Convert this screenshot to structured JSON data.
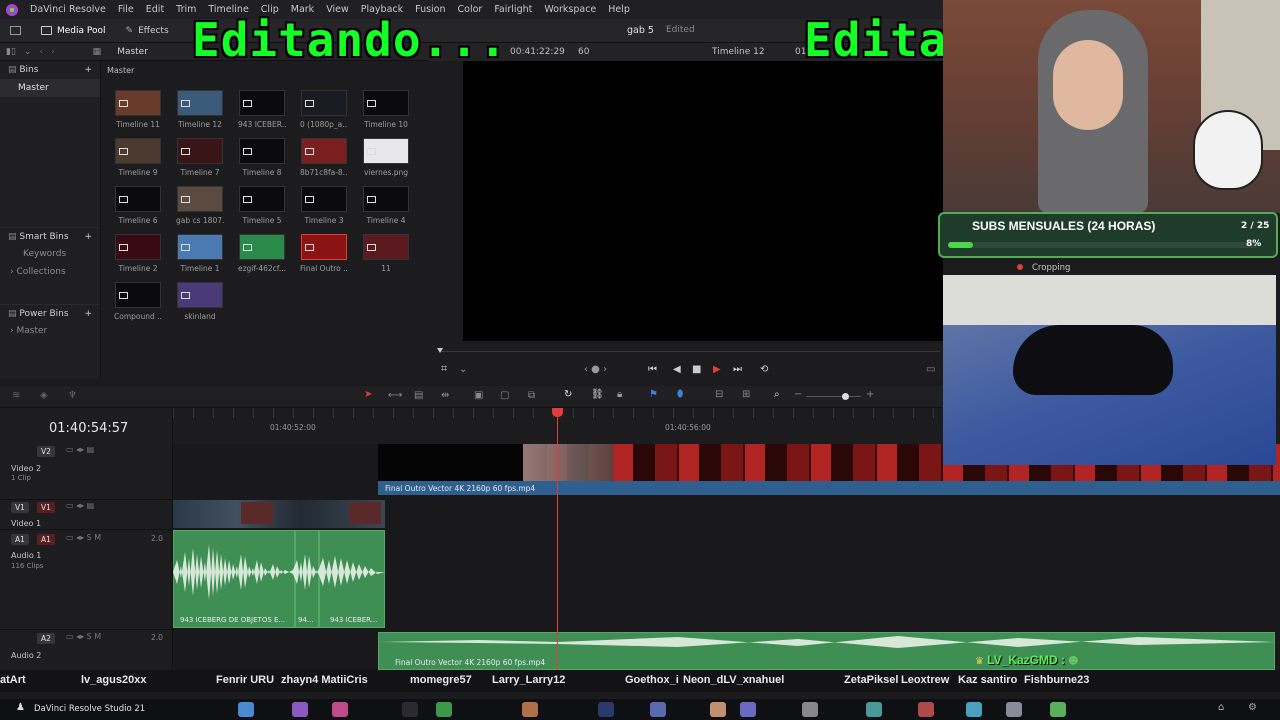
{
  "menubar": {
    "app_title": "DaVinci Resolve",
    "items": [
      "File",
      "Edit",
      "Trim",
      "Timeline",
      "Clip",
      "Mark",
      "View",
      "Playback",
      "Fusion",
      "Color",
      "Fairlight",
      "Workspace",
      "Help"
    ]
  },
  "toolbar": {
    "media_pool": "Media Pool",
    "effects": "Effects",
    "project_name": "gab 5",
    "project_status": "Edited"
  },
  "pathbar": {
    "current_bin": "Master"
  },
  "bins": {
    "header": "Bins",
    "master": "Master",
    "smart_bins_header": "Smart Bins",
    "smart_items": [
      "Keywords",
      "Collections"
    ],
    "power_bins_header": "Power Bins",
    "power_items": [
      "Master"
    ]
  },
  "mediapool": {
    "header": "Master",
    "clips": [
      {
        "label": "Timeline 11"
      },
      {
        "label": "Timeline 12"
      },
      {
        "label": "943 ICEBER..."
      },
      {
        "label": "0 (1080p_a..."
      },
      {
        "label": "Timeline 10"
      },
      {
        "label": "Timeline 9"
      },
      {
        "label": "Timeline 7"
      },
      {
        "label": "Timeline 8"
      },
      {
        "label": "8b71c8fa-8..."
      },
      {
        "label": "viernes.png"
      },
      {
        "label": "Timeline 6"
      },
      {
        "label": "gab cs 1807..."
      },
      {
        "label": "Timeline 5"
      },
      {
        "label": "Timeline 3"
      },
      {
        "label": "Timeline 4"
      },
      {
        "label": "Timeline 2"
      },
      {
        "label": "Timeline 1"
      },
      {
        "label": "ezgif-462cf..."
      },
      {
        "label": "Final Outro ..."
      },
      {
        "label": "11"
      },
      {
        "label": "Compound ..."
      },
      {
        "label": "skinland"
      }
    ]
  },
  "viewer": {
    "timecode": "00:41:22:29",
    "fps": "60",
    "timeline_name": "Timeline 12",
    "overlay_num": "01"
  },
  "timeline": {
    "current_timecode": "01:40:54:57",
    "ruler_marks": [
      "01:40:52:00",
      "01:40:56:00"
    ],
    "tracks": {
      "v2": {
        "code": "V2",
        "name": "Video 2",
        "sub": "1 Clip"
      },
      "v1": {
        "code": "V1",
        "name": "Video 1",
        "sub": ""
      },
      "a1": {
        "code": "A1",
        "name": "Audio 1",
        "sub": "116 Clips",
        "level": "2.0"
      },
      "a2": {
        "code": "A2",
        "name": "Audio 2",
        "sub": "",
        "level": "2.0"
      }
    },
    "clips": {
      "v2_clip": "Final Outro Vector 4K 2160p 60 fps.mp4",
      "a1_clip_1": "943 ICEBERG DE OBJETOS E...",
      "a1_clip_2": "94...",
      "a1_clip_3": "943 ICEBER...",
      "a2_clip": "Final Outro Vector 4K 2160p 60 fps.mp4"
    }
  },
  "stream_overlay": {
    "editing_text_1": "Editando...",
    "editing_text_2": "Edita",
    "subs_title": "SUBS MENSUALES (24 HORAS)",
    "subs_count": "2 / 25",
    "subs_percent": "8%",
    "subs_progress": 0.08,
    "cropping_label": "Cropping",
    "chat_user": "LV_KazGMD :"
  },
  "chat_names": [
    {
      "name": "atArt"
    },
    {
      "name": "lv_agus20xx"
    },
    {
      "name": "Fenrir URU"
    },
    {
      "name": "zhayn4 MatiiCris"
    },
    {
      "name": "momegre57"
    },
    {
      "name": "Larry_Larry12"
    },
    {
      "name": "Goethox_i"
    },
    {
      "name": "Neon_dLV_xnahuel"
    },
    {
      "name": "ZetaPiksel"
    },
    {
      "name": "Leoxtrew"
    },
    {
      "name": "Kaz santiro"
    },
    {
      "name": "Fishburne23"
    }
  ],
  "taskbar": {
    "app_label": "DaVinci Resolve Studio 21"
  },
  "colors": {
    "green_overlay": "#14ff26",
    "audio_clip": "#3f8f55",
    "video_clip": "#2f5f8f",
    "playhead": "#e23c3c"
  }
}
